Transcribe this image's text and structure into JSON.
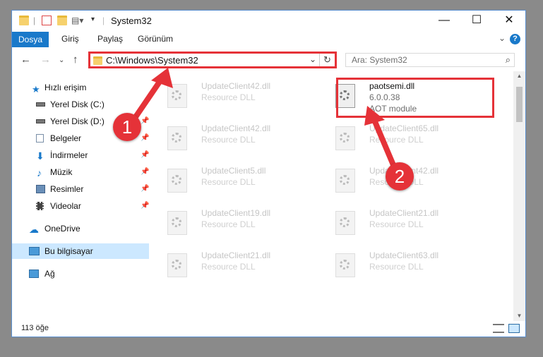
{
  "window": {
    "title": "System32",
    "controls": {
      "minimize": "—",
      "maximize": "☐",
      "close": "✕"
    }
  },
  "ribbon": {
    "tabs": [
      "Dosya",
      "Giriş",
      "Paylaş",
      "Görünüm"
    ],
    "help": "?"
  },
  "nav": {
    "address_path": "C:\\Windows\\System32",
    "search_placeholder": "Ara: System32"
  },
  "sidebar": {
    "quick_access": "Hızlı erişim",
    "items": [
      {
        "label": "Yerel Disk (C:)",
        "icon": "drive-icon"
      },
      {
        "label": "Yerel Disk (D:)",
        "icon": "drive-icon"
      },
      {
        "label": "Belgeler",
        "icon": "documents-icon"
      },
      {
        "label": "İndirmeler",
        "icon": "downloads-icon"
      },
      {
        "label": "Müzik",
        "icon": "music-icon"
      },
      {
        "label": "Resimler",
        "icon": "pictures-icon"
      },
      {
        "label": "Videolar",
        "icon": "videos-icon"
      }
    ],
    "onedrive": "OneDrive",
    "this_pc": "Bu bilgisayar",
    "network": "Ağ"
  },
  "files": {
    "left_column": [
      {
        "name": "UpdateClient42.dll",
        "type": "Resource DLL"
      },
      {
        "name": "UpdateClient42.dll",
        "type": "Resource DLL"
      },
      {
        "name": "UpdateClient5.dll",
        "type": "Resource DLL"
      },
      {
        "name": "UpdateClient19.dll",
        "type": "Resource DLL"
      },
      {
        "name": "UpdateClient21.dll",
        "type": "Resource DLL"
      }
    ],
    "right_column": [
      {
        "name": "UpdateClient65.dll",
        "type": "Resource DLL"
      },
      {
        "name": "UpdateClient42.dll",
        "type": "Resource DLL"
      },
      {
        "name": "UpdateClient21.dll",
        "type": "Resource DLL"
      },
      {
        "name": "UpdateClient63.dll",
        "type": "Resource DLL"
      }
    ],
    "target": {
      "name": "paotsemi.dll",
      "version": "6.0.0.38",
      "description": "AOT module"
    }
  },
  "status": {
    "item_count": "113 öğe"
  },
  "callouts": {
    "one": "1",
    "two": "2"
  },
  "colors": {
    "accent": "#1979ca",
    "highlight": "#e53238",
    "selected": "#cce8ff"
  }
}
